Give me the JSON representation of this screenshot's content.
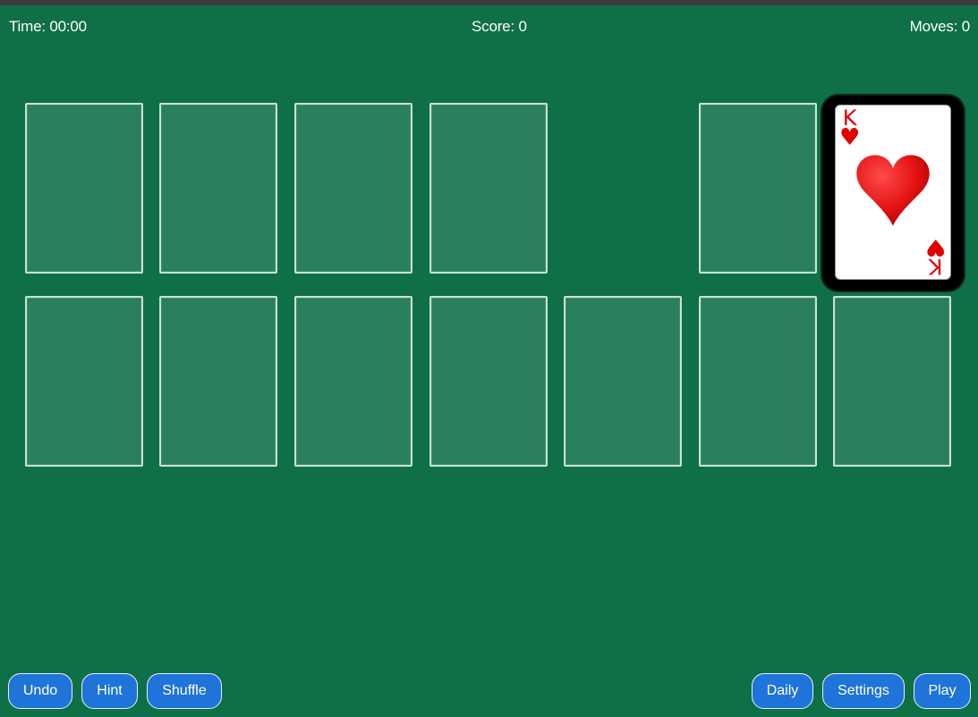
{
  "status": {
    "time": "Time: 00:00",
    "score": "Score: 0",
    "moves": "Moves: 0"
  },
  "card": {
    "rank": "K",
    "suit": "♥",
    "suit_name": "hearts",
    "color": "#e00000"
  },
  "buttons": {
    "undo": "Undo",
    "hint": "Hint",
    "shuffle": "Shuffle",
    "daily": "Daily",
    "settings": "Settings",
    "play": "Play"
  },
  "colors": {
    "felt": "#0f6f46",
    "slot": "#2a7f5d",
    "button": "#1e74d8"
  }
}
